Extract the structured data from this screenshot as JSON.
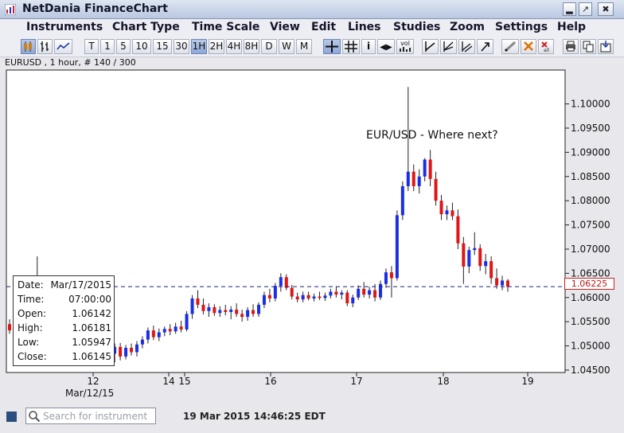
{
  "window": {
    "title": "NetDania FinanceChart"
  },
  "menu": [
    "Instruments",
    "Chart Type",
    "Time Scale",
    "View",
    "Edit",
    "Lines",
    "Studies",
    "Zoom",
    "Settings",
    "Help"
  ],
  "toolbar": {
    "timescales": [
      "T",
      "1",
      "5",
      "10",
      "15",
      "30",
      "1H",
      "2H",
      "4H",
      "8H",
      "D",
      "W",
      "M"
    ],
    "selected_timescale": "1H",
    "vol_label": "vol"
  },
  "chart_header": "EURUSD , 1 hour, # 140 / 300",
  "annotation": "EUR/USD - Where next?",
  "current_price": "1.06225",
  "info_box": [
    {
      "label": "Date:",
      "value": "Mar/17/2015"
    },
    {
      "label": "Time:",
      "value": "07:00:00"
    },
    {
      "label": "Open:",
      "value": "1.06142"
    },
    {
      "label": "High:",
      "value": "1.06181"
    },
    {
      "label": "Low:",
      "value": "1.05947"
    },
    {
      "label": "Close:",
      "value": "1.06145"
    }
  ],
  "status": {
    "search_placeholder": "Search for instrument",
    "timestamp": "19 Mar 2015 14:46:25 EDT"
  },
  "chart_data": {
    "type": "candlestick",
    "y_ticks": [
      "1.10000",
      "1.09500",
      "1.09000",
      "1.08500",
      "1.08000",
      "1.07500",
      "1.07000",
      "1.06500",
      "1.06000",
      "1.05500",
      "1.05000",
      "1.04500"
    ],
    "y_range": [
      1.0445,
      1.107
    ],
    "x_ticks": [
      {
        "label": "12",
        "day": 12
      },
      {
        "label": "14",
        "day": 14
      },
      {
        "label": "15",
        "day": 15
      },
      {
        "label": "16",
        "day": 16
      },
      {
        "label": "17",
        "day": 17
      },
      {
        "label": "18",
        "day": 18
      },
      {
        "label": "19",
        "day": 19
      }
    ],
    "x_sublabel": "Mar/12/15",
    "current_price_line": 1.06225,
    "up_color": "#1a2ee6",
    "down_color": "#e01515",
    "candles": [
      [
        1.0545,
        1.0555,
        1.0525,
        1.0532
      ],
      [
        1.0532,
        1.0541,
        1.0508,
        1.0518
      ],
      [
        1.0518,
        1.0624,
        1.051,
        1.0612
      ],
      [
        1.0612,
        1.063,
        1.0595,
        1.0605
      ],
      [
        1.0605,
        1.0625,
        1.0598,
        1.0618
      ],
      [
        1.0618,
        1.0685,
        1.06,
        1.0622
      ],
      [
        1.0622,
        1.064,
        1.0605,
        1.0611
      ],
      [
        1.0611,
        1.0632,
        1.06,
        1.0625
      ],
      [
        1.0625,
        1.0638,
        1.0605,
        1.0614
      ],
      [
        1.0614,
        1.0628,
        1.0595,
        1.0602
      ],
      [
        1.0602,
        1.0622,
        1.0596,
        1.0617
      ],
      [
        1.0617,
        1.063,
        1.0598,
        1.0602
      ],
      [
        1.0602,
        1.0611,
        1.056,
        1.0572
      ],
      [
        1.0572,
        1.061,
        1.0566,
        1.0605
      ],
      [
        1.0605,
        1.0615,
        1.057,
        1.0576
      ],
      [
        1.0576,
        1.0586,
        1.0536,
        1.0543
      ],
      [
        1.0543,
        1.0552,
        1.0515,
        1.052
      ],
      [
        1.052,
        1.053,
        1.05,
        1.0508
      ],
      [
        1.0508,
        1.0518,
        1.0478,
        1.0484
      ],
      [
        1.0484,
        1.0505,
        1.0466,
        1.0498
      ],
      [
        1.0498,
        1.0506,
        1.047,
        1.0478
      ],
      [
        1.0478,
        1.0502,
        1.0472,
        1.0496
      ],
      [
        1.0496,
        1.0505,
        1.048,
        1.0487
      ],
      [
        1.0487,
        1.051,
        1.0478,
        1.0503
      ],
      [
        1.0503,
        1.052,
        1.0495,
        1.0513
      ],
      [
        1.0513,
        1.0538,
        1.0505,
        1.0532
      ],
      [
        1.0532,
        1.0542,
        1.0512,
        1.0518
      ],
      [
        1.0518,
        1.0536,
        1.051,
        1.0528
      ],
      [
        1.0528,
        1.054,
        1.052,
        1.0535
      ],
      [
        1.0535,
        1.0545,
        1.0522,
        1.053
      ],
      [
        1.053,
        1.0548,
        1.0525,
        1.054
      ],
      [
        1.054,
        1.0552,
        1.0528,
        1.0534
      ],
      [
        1.0534,
        1.0572,
        1.053,
        1.0566
      ],
      [
        1.0566,
        1.0605,
        1.0556,
        1.0598
      ],
      [
        1.0598,
        1.0615,
        1.0578,
        1.0585
      ],
      [
        1.0585,
        1.0598,
        1.0565,
        1.0572
      ],
      [
        1.0572,
        1.0588,
        1.056,
        1.058
      ],
      [
        1.058,
        1.0586,
        1.0562,
        1.0568
      ],
      [
        1.0568,
        1.0582,
        1.056,
        1.0574
      ],
      [
        1.0574,
        1.0585,
        1.0563,
        1.057
      ],
      [
        1.057,
        1.0582,
        1.0555,
        1.0575
      ],
      [
        1.0575,
        1.0588,
        1.056,
        1.0566
      ],
      [
        1.0566,
        1.0575,
        1.055,
        1.056
      ],
      [
        1.056,
        1.058,
        1.0552,
        1.0574
      ],
      [
        1.0574,
        1.0586,
        1.056,
        1.0566
      ],
      [
        1.0566,
        1.059,
        1.056,
        1.0585
      ],
      [
        1.0585,
        1.0612,
        1.0578,
        1.0605
      ],
      [
        1.0605,
        1.0618,
        1.059,
        1.0598
      ],
      [
        1.0598,
        1.063,
        1.0592,
        1.0624
      ],
      [
        1.0624,
        1.065,
        1.0612,
        1.0642
      ],
      [
        1.0642,
        1.0648,
        1.0615,
        1.062
      ],
      [
        1.062,
        1.0626,
        1.0596,
        1.0602
      ],
      [
        1.0602,
        1.061,
        1.059,
        1.0596
      ],
      [
        1.0596,
        1.0612,
        1.059,
        1.0605
      ],
      [
        1.0605,
        1.0612,
        1.0594,
        1.0598
      ],
      [
        1.0598,
        1.0608,
        1.0592,
        1.0602
      ],
      [
        1.0602,
        1.0612,
        1.0595,
        1.0599
      ],
      [
        1.0599,
        1.061,
        1.0593,
        1.0604
      ],
      [
        1.0604,
        1.0618,
        1.0598,
        1.0612
      ],
      [
        1.0612,
        1.0622,
        1.06,
        1.0606
      ],
      [
        1.0606,
        1.0615,
        1.0596,
        1.061
      ],
      [
        1.061,
        1.0615,
        1.0582,
        1.0588
      ],
      [
        1.0588,
        1.0606,
        1.058,
        1.06
      ],
      [
        1.06,
        1.0625,
        1.0595,
        1.0618
      ],
      [
        1.0618,
        1.0632,
        1.06,
        1.0606
      ],
      [
        1.0606,
        1.0622,
        1.0598,
        1.0615
      ],
      [
        1.0615,
        1.0628,
        1.0592,
        1.06
      ],
      [
        1.06,
        1.0635,
        1.0595,
        1.0628
      ],
      [
        1.0628,
        1.066,
        1.062,
        1.0652
      ],
      [
        1.0652,
        1.0665,
        1.06,
        1.064
      ],
      [
        1.064,
        1.078,
        1.0635,
        1.077
      ],
      [
        1.077,
        1.084,
        1.076,
        1.083
      ],
      [
        1.083,
        1.1035,
        1.082,
        1.086
      ],
      [
        1.086,
        1.0875,
        1.082,
        1.083
      ],
      [
        1.083,
        1.0865,
        1.0815,
        1.085
      ],
      [
        1.085,
        1.0888,
        1.084,
        1.0885
      ],
      [
        1.0885,
        1.0905,
        1.083,
        1.0845
      ],
      [
        1.0845,
        1.086,
        1.079,
        1.08
      ],
      [
        1.08,
        1.0812,
        1.076,
        1.0772
      ],
      [
        1.0772,
        1.079,
        1.076,
        1.078
      ],
      [
        1.078,
        1.0796,
        1.076,
        1.0768
      ],
      [
        1.0768,
        1.0782,
        1.07,
        1.0712
      ],
      [
        1.0712,
        1.0725,
        1.0628,
        1.0664
      ],
      [
        1.0664,
        1.0705,
        1.065,
        1.0698
      ],
      [
        1.0698,
        1.0735,
        1.0688,
        1.0702
      ],
      [
        1.0702,
        1.071,
        1.0655,
        1.0665
      ],
      [
        1.0665,
        1.069,
        1.0648,
        1.0675
      ],
      [
        1.0675,
        1.0685,
        1.0628,
        1.064
      ],
      [
        1.064,
        1.066,
        1.0618,
        1.0625
      ],
      [
        1.0625,
        1.0645,
        1.0615,
        1.0635
      ],
      [
        1.0635,
        1.0638,
        1.0612,
        1.0622
      ]
    ]
  }
}
